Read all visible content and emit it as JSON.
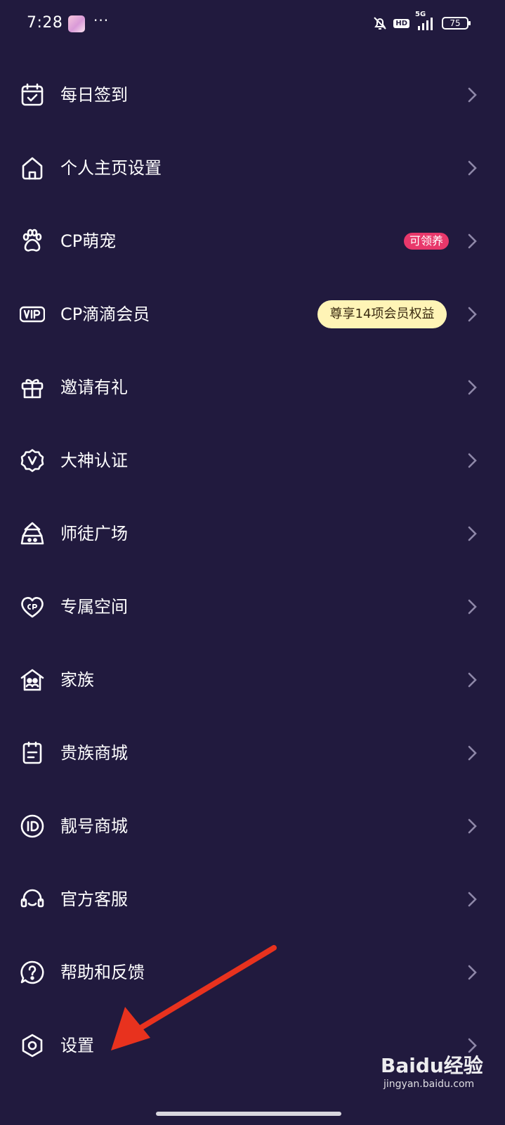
{
  "status_bar": {
    "time": "7:28",
    "more": "···",
    "network": "5G",
    "hd": "HD",
    "battery": "75"
  },
  "menu": {
    "items": [
      {
        "label": "每日签到",
        "icon": "calendar-check-icon"
      },
      {
        "label": "个人主页设置",
        "icon": "home-icon"
      },
      {
        "label": "CP萌宠",
        "icon": "paw-icon",
        "badge": "可领养"
      },
      {
        "label": "CP滴滴会员",
        "icon": "vip-icon",
        "badge": "尊享14项会员权益"
      },
      {
        "label": "邀请有礼",
        "icon": "gift-icon"
      },
      {
        "label": "大神认证",
        "icon": "verified-v-icon"
      },
      {
        "label": "师徒广场",
        "icon": "mentor-icon"
      },
      {
        "label": "专属空间",
        "icon": "cp-heart-icon"
      },
      {
        "label": "家族",
        "icon": "family-house-icon"
      },
      {
        "label": "贵族商城",
        "icon": "noble-shop-icon"
      },
      {
        "label": "靓号商城",
        "icon": "id-icon"
      },
      {
        "label": "官方客服",
        "icon": "headset-icon"
      },
      {
        "label": "帮助和反馈",
        "icon": "help-icon"
      },
      {
        "label": "设置",
        "icon": "settings-hexagon-icon"
      }
    ]
  },
  "colors": {
    "background": "#211a3e",
    "badge_pink": "#e8386b",
    "badge_vip": "#fff4b6",
    "annotation_arrow": "#e8321e"
  },
  "watermark": {
    "logo": "Baidu经验",
    "sub": "jingyan.baidu.com"
  }
}
